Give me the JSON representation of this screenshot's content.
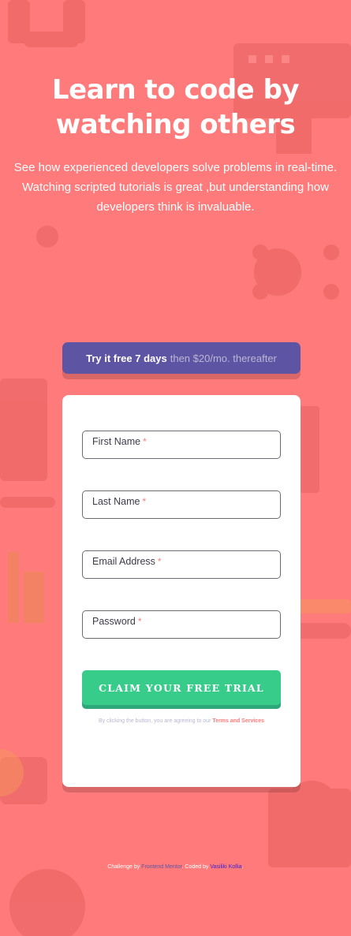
{
  "hero": {
    "title": "Learn to code by watching others",
    "subtitle": "See how experienced developers solve problems in real-time. Watching scripted tutorials is great ,but understanding how developers think is invaluable."
  },
  "promo": {
    "strong": "Try it free 7 days",
    "light": "then $20/mo. thereafter"
  },
  "form": {
    "fields": [
      {
        "label": "First Name",
        "required_mark": "*"
      },
      {
        "label": "Last Name",
        "required_mark": "*"
      },
      {
        "label": "Email Address",
        "required_mark": "*"
      },
      {
        "label": "Password",
        "required_mark": "*"
      }
    ],
    "submit_label": "CLAIM YOUR FREE TRIAL",
    "terms_prefix": "By clicking the button, you are agreeing to our",
    "terms_link": "Terms and Services"
  },
  "attribution": {
    "prefix": "Challenge by",
    "link1": "Frontend Mentor",
    "middle": ". Coded by",
    "link2": "Vasiliki Kollia",
    "suffix": "."
  },
  "colors": {
    "background": "#ff7a7a",
    "promo": "#5e54a4",
    "submit": "#38cc8b",
    "card": "#ffffff"
  },
  "icons": {
    "background_decor": "developer-pattern-icons"
  }
}
